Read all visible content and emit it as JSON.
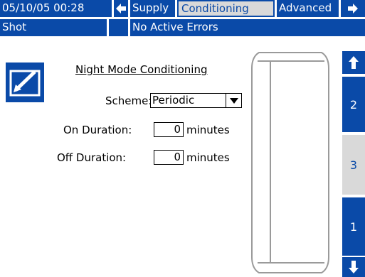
{
  "header": {
    "datetime": "05/10/05 00:28",
    "tabs": [
      {
        "label": "Supply",
        "active": false
      },
      {
        "label": "Conditioning",
        "active": true
      },
      {
        "label": "Advanced",
        "active": false
      }
    ],
    "status_left": "Shot",
    "status_message": "No Active Errors"
  },
  "form": {
    "title": "Night Mode Conditioning",
    "scheme_label": "Scheme:",
    "scheme_value": "Periodic",
    "on_label": "On Duration:",
    "on_value": "0",
    "on_unit": "minutes",
    "off_label": "Off Duration:",
    "off_value": "0",
    "off_unit": "minutes"
  },
  "pages": {
    "p2": "2",
    "p3": "3",
    "p1": "1"
  },
  "colors": {
    "primary_blue": "#0a4aa8",
    "active_gray": "#d9d9d9"
  },
  "icons": {
    "edit": "edit-icon",
    "left": "arrow-left-icon",
    "right": "arrow-right-icon",
    "up": "arrow-up-icon",
    "down": "arrow-down-icon",
    "dropdown": "dropdown-arrow-icon"
  }
}
